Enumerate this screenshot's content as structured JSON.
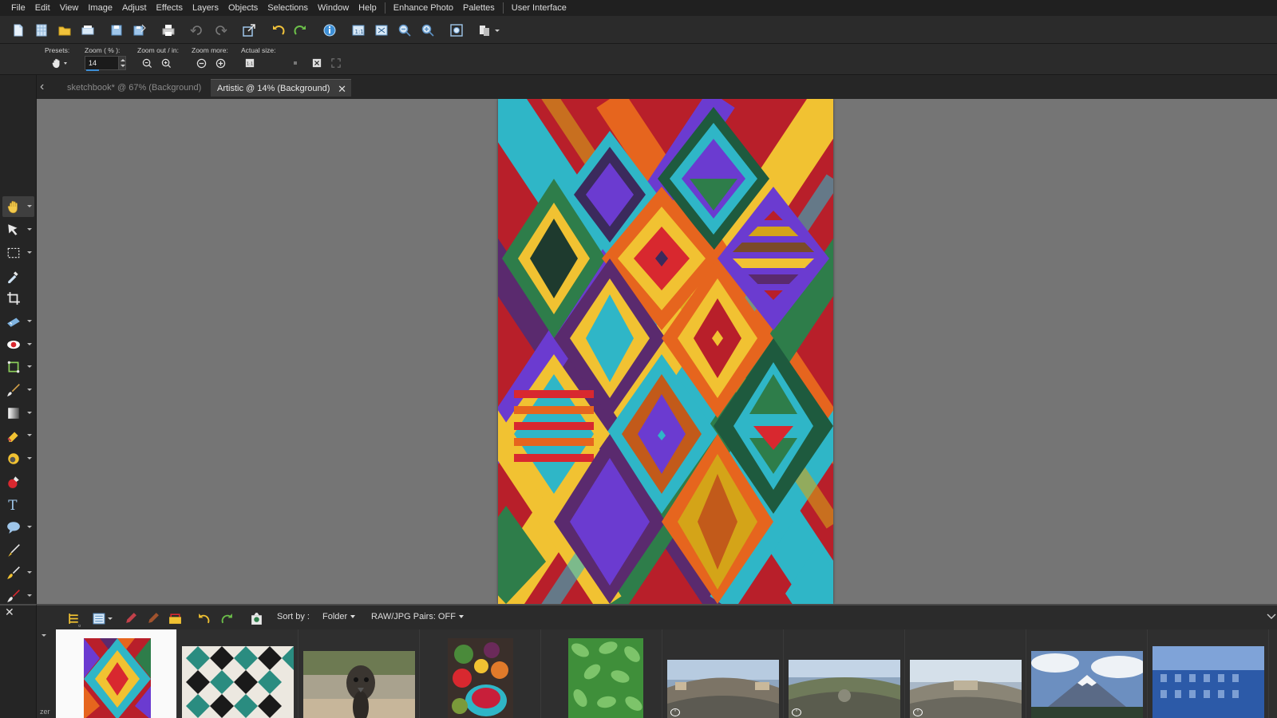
{
  "menu": {
    "items": [
      "File",
      "Edit",
      "View",
      "Image",
      "Adjust",
      "Effects",
      "Layers",
      "Objects",
      "Selections",
      "Window",
      "Help"
    ],
    "extra_items": [
      "Enhance Photo",
      "Palettes"
    ],
    "user_interface": "User Interface"
  },
  "toolbar": {
    "icons": [
      "new-icon",
      "new-from-template-icon",
      "open-icon",
      "scan-icon",
      "save-icon",
      "save-as-icon",
      "print-icon",
      "undo-icon",
      "redo-icon",
      "resize-icon",
      "rotate-left-icon",
      "rotate-right-icon",
      "image-info-icon",
      "fit-window-icon",
      "full-screen-icon",
      "zoom-out-icon",
      "zoom-in-icon",
      "zoom-fit-icon",
      "workspace-icon"
    ]
  },
  "options": {
    "presets_label": "Presets:",
    "zoom_label": "Zoom ( % ):",
    "zoom_value": "14",
    "zoom_outin_label": "Zoom out / in:",
    "zoom_more_label": "Zoom more:",
    "actual_size_label": "Actual size:"
  },
  "tabs": [
    {
      "label": "sketchbook* @  67% (Background)",
      "active": false
    },
    {
      "label": "Artistic @  14% (Background)",
      "active": true
    }
  ],
  "tools": [
    "pan-tool",
    "pick-tool",
    "selection-tool",
    "dropper-tool",
    "crop-tool",
    "straighten-tool",
    "red-eye-tool",
    "perspective-tool",
    "paint-brush-tool",
    "gradient-tool",
    "eraser-tool",
    "dodge-tool",
    "color-replacer-tool",
    "text-tool",
    "preset-shape-tool",
    "pen-tool",
    "retouch-tool",
    "clone-tool",
    "add-tool"
  ],
  "organizer": {
    "sort_by_label": "Sort by :",
    "sort_value": "Folder",
    "raw_jpg_label": "RAW/JPG Pairs: OFF",
    "side_label": "zer",
    "thumbnails": [
      "artistic-pattern",
      "tiles",
      "emu",
      "fruit-bowl",
      "green-leaves",
      "pano-street-1",
      "pano-street-2",
      "pano-street-3",
      "volcano-mountain",
      "blue-building"
    ]
  },
  "colors": {
    "accent": "#3d8fd6",
    "workspace": "#757575",
    "panel": "#2b2b2b"
  }
}
